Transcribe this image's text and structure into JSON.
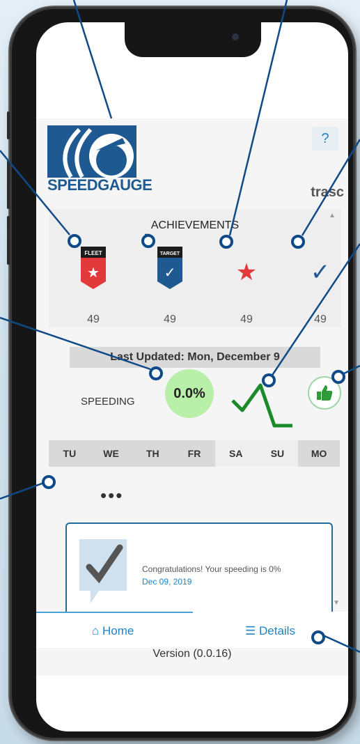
{
  "app": {
    "brand": "SPEEDGAUGE",
    "help_label": "?",
    "user_name": "trasc"
  },
  "achievements": {
    "title": "ACHIEVEMENTS",
    "badges": [
      {
        "icon": "fleet-badge-icon",
        "label": "FLEET",
        "count": "49",
        "color": "#e23a3a"
      },
      {
        "icon": "target-badge-icon",
        "label": "TARGET",
        "count": "49",
        "color": "#1e5a91"
      },
      {
        "icon": "star-icon",
        "count": "49",
        "color": "#e23a3a"
      },
      {
        "icon": "check-icon",
        "count": "49",
        "color": "#1e5a91"
      }
    ]
  },
  "status": {
    "last_updated": "Last Updated: Mon, December 9",
    "metric_label": "SPEEDING",
    "metric_value": "0.0%"
  },
  "days": [
    {
      "label": "TU",
      "color": "#d9d9d9"
    },
    {
      "label": "WE",
      "color": "#d9d9d9"
    },
    {
      "label": "TH",
      "color": "#d9d9d9"
    },
    {
      "label": "FR",
      "color": "#d9d9d9"
    },
    {
      "label": "SA",
      "color": "#eeeeee"
    },
    {
      "label": "SU",
      "color": "#eeeeee"
    },
    {
      "label": "MO",
      "color": "#d9d9d9"
    }
  ],
  "more_label": "•••",
  "notification": {
    "message": "Congratulations! Your speeding is 0%",
    "date": "Dec 09, 2019"
  },
  "tabs": {
    "home": "Home",
    "details": "Details"
  },
  "version": "Version (0.0.16)",
  "colors": {
    "brand_blue": "#1e5a91",
    "link_blue": "#1d83c6",
    "callout_blue": "#0e4a87",
    "trend_green": "#1b8a2a",
    "speeding_bg": "#b9f0a9"
  }
}
